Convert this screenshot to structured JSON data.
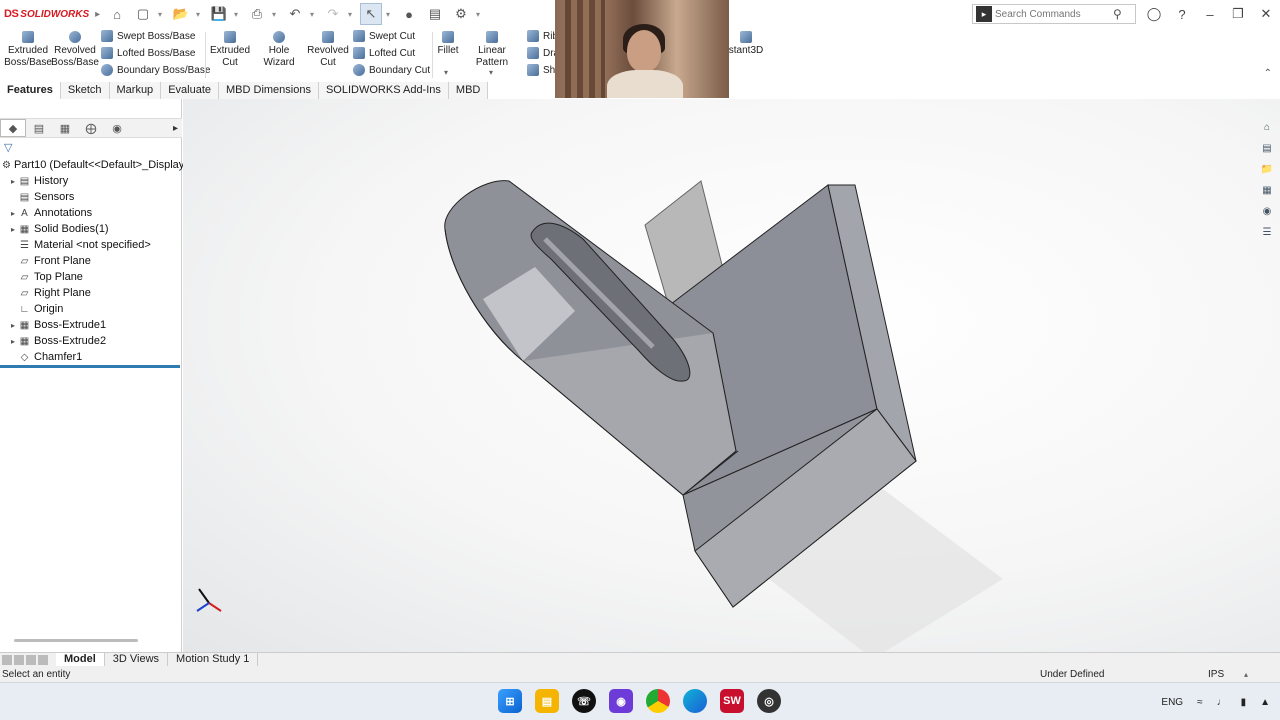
{
  "app": {
    "brand_ds": "DS",
    "brand_name": "SOLIDWORKS"
  },
  "search": {
    "placeholder": "Search Commands"
  },
  "ribbon": {
    "extruded_boss": "Extruded Boss/Base",
    "revolved_boss": "Revolved Boss/Base",
    "swept_boss": "Swept Boss/Base",
    "lofted_boss": "Lofted Boss/Base",
    "boundary_boss": "Boundary Boss/Base",
    "extruded_cut": "Extruded Cut",
    "hole_wizard": "Hole Wizard",
    "revolved_cut": "Revolved Cut",
    "swept_cut": "Swept Cut",
    "lofted_cut": "Lofted Cut",
    "boundary_cut": "Boundary Cut",
    "fillet": "Fillet",
    "linear_pattern": "Linear Pattern",
    "rib": "Rib",
    "draft": "Dra",
    "shell": "She",
    "instant3d": "stant3D"
  },
  "tabs": [
    "Features",
    "Sketch",
    "Markup",
    "Evaluate",
    "MBD Dimensions",
    "SOLIDWORKS Add-Ins",
    "MBD"
  ],
  "tree": {
    "root": "Part10  (Default<<Default>_Display",
    "items": [
      {
        "label": "History",
        "icon": "history-icon",
        "expandable": true
      },
      {
        "label": "Sensors",
        "icon": "sensors-icon",
        "expandable": false
      },
      {
        "label": "Annotations",
        "icon": "annotations-icon",
        "expandable": true
      },
      {
        "label": "Solid Bodies(1)",
        "icon": "solid-bodies-icon",
        "expandable": true
      },
      {
        "label": "Material <not specified>",
        "icon": "material-icon",
        "expandable": false
      },
      {
        "label": "Front Plane",
        "icon": "plane-icon",
        "expandable": false
      },
      {
        "label": "Top Plane",
        "icon": "plane-icon",
        "expandable": false
      },
      {
        "label": "Right Plane",
        "icon": "plane-icon",
        "expandable": false
      },
      {
        "label": "Origin",
        "icon": "origin-icon",
        "expandable": false
      },
      {
        "label": "Boss-Extrude1",
        "icon": "extrude-icon",
        "expandable": true
      },
      {
        "label": "Boss-Extrude2",
        "icon": "extrude-icon",
        "expandable": true
      },
      {
        "label": "Chamfer1",
        "icon": "chamfer-icon",
        "expandable": false
      }
    ]
  },
  "bottom_tabs": [
    "Model",
    "3D Views",
    "Motion Study 1"
  ],
  "status": {
    "message": "Select an entity",
    "definition": "Under Defined",
    "units": "IPS"
  },
  "tray": {
    "language": "ENG"
  },
  "colors": {
    "accent": "#2f7cb3",
    "brand": "#d71920",
    "part_face": "#9a9ca3"
  }
}
